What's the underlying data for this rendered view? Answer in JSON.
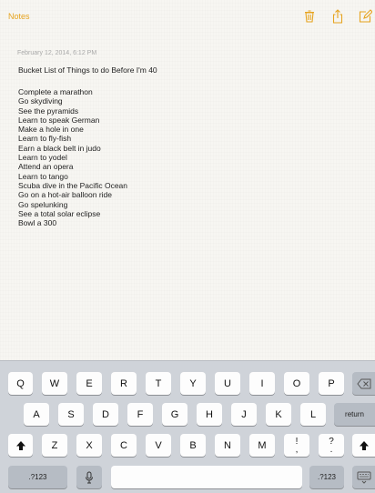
{
  "nav": {
    "back_label": "Notes",
    "accent_color": "#e6a31e",
    "icons": [
      "trash-icon",
      "share-icon",
      "compose-icon"
    ]
  },
  "note": {
    "timestamp": "February 12, 2014, 6:12 PM",
    "title": "Bucket List of Things to do Before I'm 40",
    "items": [
      "Complete a marathon",
      "Go skydiving",
      "See the pyramids",
      "Learn to speak German",
      "Make a hole in one",
      "Learn to fly-fish",
      "Earn a black belt in judo",
      "Learn to yodel",
      "Attend an opera",
      "Learn to tango",
      "Scuba dive in the Pacific Ocean",
      "Go on a hot-air balloon ride",
      "Go spelunking",
      "See a total solar eclipse",
      "Bowl a 300"
    ]
  },
  "keyboard": {
    "row1": [
      "Q",
      "W",
      "E",
      "R",
      "T",
      "Y",
      "U",
      "I",
      "O",
      "P"
    ],
    "row2": [
      "A",
      "S",
      "D",
      "F",
      "G",
      "H",
      "J",
      "K",
      "L"
    ],
    "row3": [
      "Z",
      "X",
      "C",
      "V",
      "B",
      "N",
      "M"
    ],
    "punct1": [
      "!",
      ","
    ],
    "punct2": [
      "?",
      "."
    ],
    "return_label": "return",
    "numbers_label": ".?123",
    "icons": [
      "backspace-icon",
      "shift-icon",
      "microphone-icon",
      "keyboard-dismiss-icon"
    ]
  }
}
